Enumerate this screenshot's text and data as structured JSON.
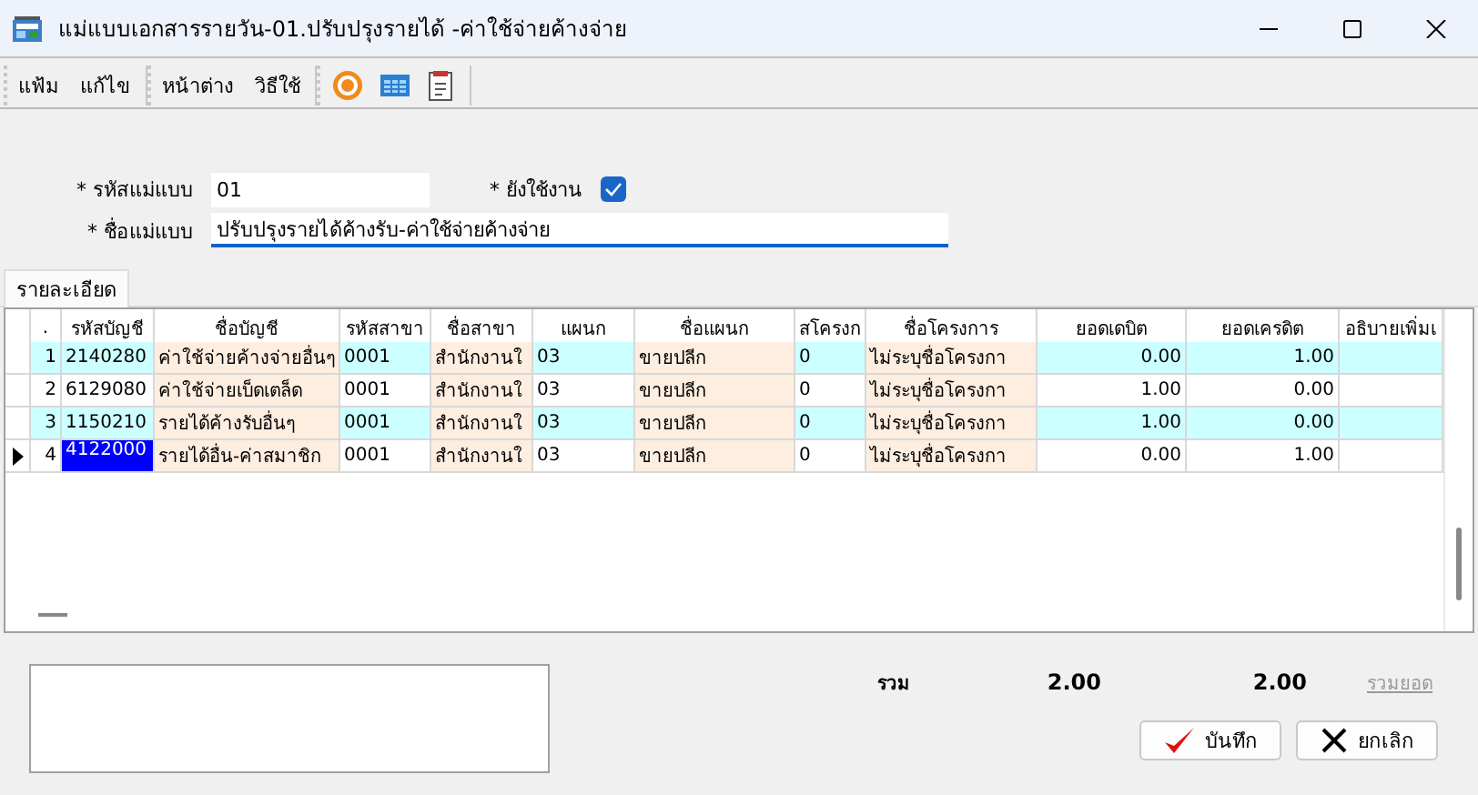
{
  "window": {
    "title": "แม่แบบเอกสารรายวัน-01.ปรับปรุงรายได้ -ค่าใช้จ่ายค้างจ่าย"
  },
  "menu_groups": [
    [
      "แฟ้ม",
      "แก้ไข"
    ],
    [
      "หน้าต่าง",
      "วิธีใช้"
    ]
  ],
  "form": {
    "code": {
      "label": "* รหัสแม่แบบ",
      "value": "01"
    },
    "active": {
      "label": "* ยังใช้งาน",
      "checked": true
    },
    "name": {
      "label": "* ชื่อแม่แบบ",
      "value": "ปรับปรุงรายได้ค้างรับ-ค่าใช้จ่ายค้างจ่าย"
    }
  },
  "tabs": [
    {
      "label": "รายละเอียด",
      "selected": true
    }
  ],
  "table": {
    "columns": [
      {
        "label": ".",
        "kind": "number"
      },
      {
        "label": "รหัสบัญชี",
        "kind": "text"
      },
      {
        "label": "ชื่อบัญชี",
        "kind": "name"
      },
      {
        "label": "รหัสสาขา",
        "kind": "text"
      },
      {
        "label": "ชื่อสาขา",
        "kind": "name"
      },
      {
        "label": "แผนก",
        "kind": "text"
      },
      {
        "label": "ชื่อแผนก",
        "kind": "name"
      },
      {
        "label": "สโครงก",
        "kind": "text"
      },
      {
        "label": "ชื่อโครงการ",
        "kind": "name"
      },
      {
        "label": "ยอดเดบิต",
        "kind": "number"
      },
      {
        "label": "ยอดเครดิต",
        "kind": "number"
      },
      {
        "label": "อธิบายเพิ่มเ",
        "kind": "text"
      }
    ],
    "rows": [
      {
        "current": false,
        "cells": [
          "1",
          "2140280",
          "ค่าใช้จ่ายค้างจ่ายอื่นๆ",
          "0001",
          "สำนักงานใ",
          "03",
          "ขายปลีก",
          "0",
          "ไม่ระบุชื่อโครงกา",
          "0.00",
          "1.00"
        ]
      },
      {
        "current": false,
        "cells": [
          "2",
          "6129080",
          "ค่าใช้จ่ายเบ็ดเตล็ด",
          "0001",
          "สำนักงานใ",
          "03",
          "ขายปลีก",
          "0",
          "ไม่ระบุชื่อโครงกา",
          "1.00",
          "0.00"
        ]
      },
      {
        "current": false,
        "cells": [
          "3",
          "1150210",
          "รายได้ค้างรับอื่นๆ",
          "0001",
          "สำนักงานใ",
          "03",
          "ขายปลีก",
          "0",
          "ไม่ระบุชื่อโครงกา",
          "1.00",
          "0.00"
        ]
      },
      {
        "current": true,
        "cells": [
          "4",
          "4122000",
          "รายได้อื่น-ค่าสมาชิก",
          "0001",
          "สำนักงานใ",
          "03",
          "ขายปลีก",
          "0",
          "ไม่ระบุชื่อโครงกา",
          "0.00",
          "1.00"
        ]
      }
    ]
  },
  "totals": {
    "label": "รวม",
    "debit": "2.00",
    "credit": "2.00",
    "link": "รวมยอด"
  },
  "buttons": [
    {
      "kind": "save",
      "label": "บันทึก"
    },
    {
      "kind": "cancel",
      "label": "ยกเลิก"
    }
  ]
}
